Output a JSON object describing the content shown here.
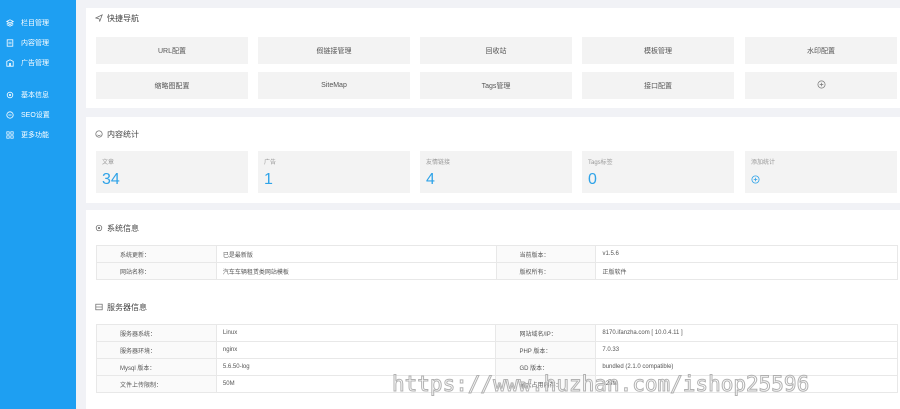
{
  "sidebar": {
    "group1": [
      {
        "label": "栏目管理",
        "icon": "layers-icon"
      },
      {
        "label": "内容管理",
        "icon": "document-icon"
      },
      {
        "label": "广告管理",
        "icon": "ad-icon"
      }
    ],
    "group2": [
      {
        "label": "基本信息",
        "icon": "info-icon"
      },
      {
        "label": "SEO设置",
        "icon": "seo-icon"
      },
      {
        "label": "更多功能",
        "icon": "grid-icon"
      }
    ]
  },
  "quick_nav": {
    "title": "快捷导航",
    "row1": [
      "URL配置",
      "假链接管理",
      "回收站",
      "模板管理",
      "水印配置"
    ],
    "row2": [
      "缩略图配置",
      "SiteMap",
      "Tags管理",
      "接口配置"
    ]
  },
  "stats": {
    "title": "内容统计",
    "items": [
      {
        "label": "文章",
        "value": "34"
      },
      {
        "label": "广告",
        "value": "1"
      },
      {
        "label": "友情链接",
        "value": "4"
      },
      {
        "label": "Tags标签",
        "value": "0"
      }
    ],
    "add_label": "添加统计"
  },
  "system": {
    "title": "系统信息",
    "rows": [
      [
        "系统更新：",
        "已是最新版",
        "当前版本：",
        "v1.5.6"
      ],
      [
        "网站名称：",
        "汽车车辆租赁类网站模板",
        "版权所有：",
        "正版软件"
      ]
    ]
  },
  "server": {
    "title": "服务器信息",
    "rows": [
      [
        "服务器系统：",
        "Linux",
        "网站域名/IP：",
        "8170.ifanzha.com [ 10.0.4.11 ]"
      ],
      [
        "服务器环境：",
        "nginx",
        "PHP 版本：",
        "7.0.33"
      ],
      [
        "Mysql 版本：",
        "5.6.50-log",
        "GD 版本：",
        "bundled (2.1.0 compatible)"
      ],
      [
        "文件上传限制：",
        "50M",
        "最大占用内存：",
        "128M"
      ]
    ]
  },
  "watermark": "https://www.huzhan.com/ishop25596",
  "colors": {
    "sidebar": "#1e9ff2",
    "accent": "#2fa3e8",
    "background": "#f1f2f6"
  }
}
